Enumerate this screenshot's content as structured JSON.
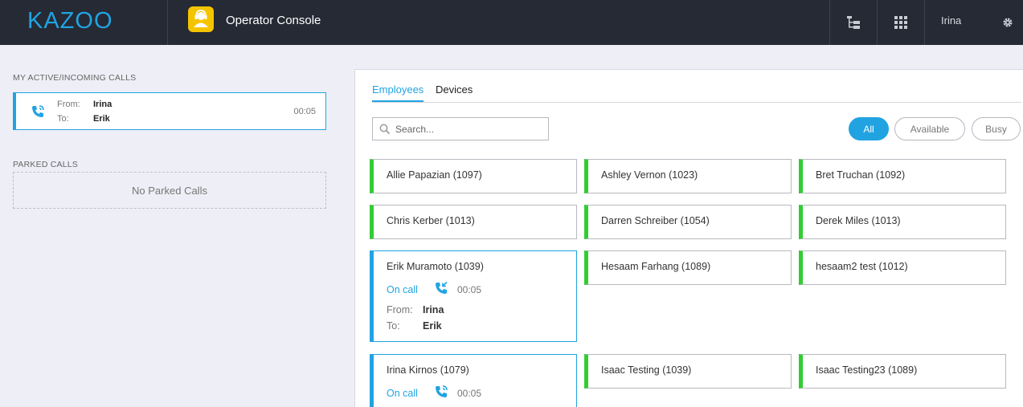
{
  "header": {
    "logo": "KAZOO",
    "app_title": "Operator Console",
    "user": "Irina",
    "tree_icon": "hierarchy-icon",
    "apps_icon": "grid-icon",
    "settings_icon": "gear-icon"
  },
  "left": {
    "active_label": "MY ACTIVE/INCOMING CALLS",
    "active_call": {
      "from_label": "From:",
      "from": "Irina",
      "to_label": "To:",
      "to": "Erik",
      "duration": "00:05"
    },
    "parked_label": "PARKED CALLS",
    "parked_empty": "No Parked Calls"
  },
  "main": {
    "tabs": [
      {
        "label": "Employees"
      },
      {
        "label": "Devices"
      }
    ],
    "search_placeholder": "Search...",
    "filters": [
      {
        "label": "All"
      },
      {
        "label": "Available"
      },
      {
        "label": "Busy"
      }
    ],
    "employees": [
      {
        "name": "Allie Papazian (1097)"
      },
      {
        "name": "Ashley Vernon (1023)"
      },
      {
        "name": "Bret Truchan (1092)"
      },
      {
        "name": "Chris Kerber (1013)"
      },
      {
        "name": "Darren Schreiber (1054)"
      },
      {
        "name": "Derek Miles (1013)"
      },
      {
        "name": "Erik Muramoto (1039)",
        "status": "On call",
        "duration": "00:05",
        "from_label": "From:",
        "from": "Irina",
        "to_label": "To:",
        "to": "Erik"
      },
      {
        "name": "Hesaam Farhang (1089)"
      },
      {
        "name": "hesaam2 test (1012)"
      },
      {
        "name": "Irina Kirnos (1079)",
        "status": "On call",
        "duration": "00:05"
      },
      {
        "name": "Isaac Testing (1039)"
      },
      {
        "name": "Isaac Testing23 (1089)"
      }
    ]
  },
  "colors": {
    "accent": "#21a3e2",
    "available": "#33cc33",
    "topbar": "#262a35",
    "app_icon": "#f5c400"
  }
}
